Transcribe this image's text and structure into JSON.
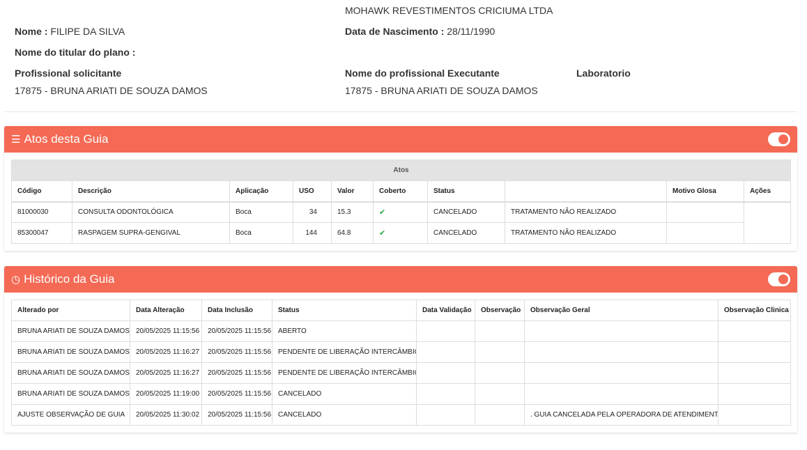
{
  "company": "MOHAWK REVESTIMENTOS CRICIUMA LTDA",
  "patient": {
    "name_label": "Nome :",
    "name": "FILIPE DA SILVA",
    "birth_label": "Data de Nascimento :",
    "birth": "28/11/1990",
    "holder_label": "Nome do titular do plano :",
    "holder": ""
  },
  "professionals": {
    "requester_label": "Profissional solicitante",
    "requester": "17875 - BRUNA ARIATI DE SOUZA DAMOS",
    "executor_label": "Nome do profissional Executante",
    "executor": "17875 - BRUNA ARIATI DE SOUZA DAMOS",
    "lab_label": "Laboratorio",
    "lab": ""
  },
  "atos_panel": {
    "title": "Atos desta Guia",
    "group_header": "Atos",
    "columns": [
      "Código",
      "Descrição",
      "Aplicação",
      "USO",
      "Valor",
      "Coberto",
      "Status",
      "",
      "Motivo Glosa",
      "Ações"
    ],
    "rows": [
      {
        "codigo": "81000030",
        "descricao": "CONSULTA ODONTOLÓGICA",
        "aplicacao": "Boca",
        "uso": "34",
        "valor": "15.3",
        "coberto": "✔",
        "status": "CANCELADO",
        "motivo": "TRATAMENTO NÃO REALIZADO",
        "glosa": ""
      },
      {
        "codigo": "85300047",
        "descricao": "RASPAGEM SUPRA-GENGIVAL",
        "aplicacao": "Boca",
        "uso": "144",
        "valor": "64.8",
        "coberto": "✔",
        "status": "CANCELADO",
        "motivo": "TRATAMENTO NÃO REALIZADO",
        "glosa": ""
      }
    ]
  },
  "historico_panel": {
    "title": "Histórico da Guia",
    "columns": [
      "Alterado por",
      "Data Alteração",
      "Data Inclusão",
      "Status",
      "Data Validação",
      "Observação",
      "Observação Geral",
      "Observação Clinica"
    ],
    "rows": [
      [
        "BRUNA ARIATI DE SOUZA DAMOS",
        "20/05/2025 11:15:56",
        "20/05/2025 11:15:56",
        "ABERTO",
        "",
        "",
        "",
        ""
      ],
      [
        "BRUNA ARIATI DE SOUZA DAMOS",
        "20/05/2025 11:16:27",
        "20/05/2025 11:15:56",
        "PENDENTE DE LIBERAÇÃO INTERCÂMBIO",
        "",
        "",
        "",
        ""
      ],
      [
        "BRUNA ARIATI DE SOUZA DAMOS",
        "20/05/2025 11:16:27",
        "20/05/2025 11:15:56",
        "PENDENTE DE LIBERAÇÃO INTERCÂMBIO",
        "",
        "",
        "",
        ""
      ],
      [
        "BRUNA ARIATI DE SOUZA DAMOS",
        "20/05/2025 11:19:00",
        "20/05/2025 11:15:56",
        "CANCELADO",
        "",
        "",
        "",
        ""
      ],
      [
        "AJUSTE OBSERVAÇÃO DE GUIA",
        "20/05/2025 11:30:02",
        "20/05/2025 11:15:56",
        "CANCELADO",
        "",
        "",
        ". GUIA CANCELADA PELA OPERADORA DE ATENDIMENTO",
        ""
      ]
    ]
  },
  "colors": {
    "accent": "#f46a55",
    "check": "#27a844"
  }
}
